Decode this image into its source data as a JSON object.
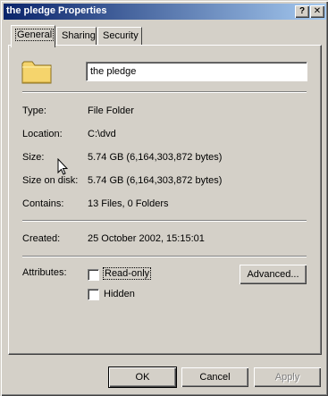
{
  "window": {
    "title": "the pledge Properties",
    "help_glyph": "?",
    "close_glyph": "✕"
  },
  "tabs": [
    {
      "label": "General",
      "active": true
    },
    {
      "label": "Sharing",
      "active": false
    },
    {
      "label": "Security",
      "active": false
    }
  ],
  "folder": {
    "icon": "folder-icon",
    "name": "the pledge"
  },
  "properties": {
    "type": {
      "label": "Type:",
      "value": "File Folder"
    },
    "location": {
      "label": "Location:",
      "value": "C:\\dvd"
    },
    "size": {
      "label": "Size:",
      "value": "5.74 GB (6,164,303,872 bytes)"
    },
    "size_on_disk": {
      "label": "Size on disk:",
      "value": "5.74 GB (6,164,303,872 bytes)"
    },
    "contains": {
      "label": "Contains:",
      "value": "13 Files, 0 Folders"
    },
    "created": {
      "label": "Created:",
      "value": "25 October 2002, 15:15:01"
    }
  },
  "attributes": {
    "label": "Attributes:",
    "read_only": {
      "label": "Read-only",
      "checked": false
    },
    "hidden": {
      "label": "Hidden",
      "checked": false
    },
    "advanced_label": "Advanced..."
  },
  "footer": {
    "ok_label": "OK",
    "cancel_label": "Cancel",
    "apply_label": "Apply"
  },
  "colors": {
    "titlebar_start": "#0a246a",
    "titlebar_end": "#a6caf0",
    "face": "#d4d0c8",
    "folder": "#f5d46c"
  }
}
